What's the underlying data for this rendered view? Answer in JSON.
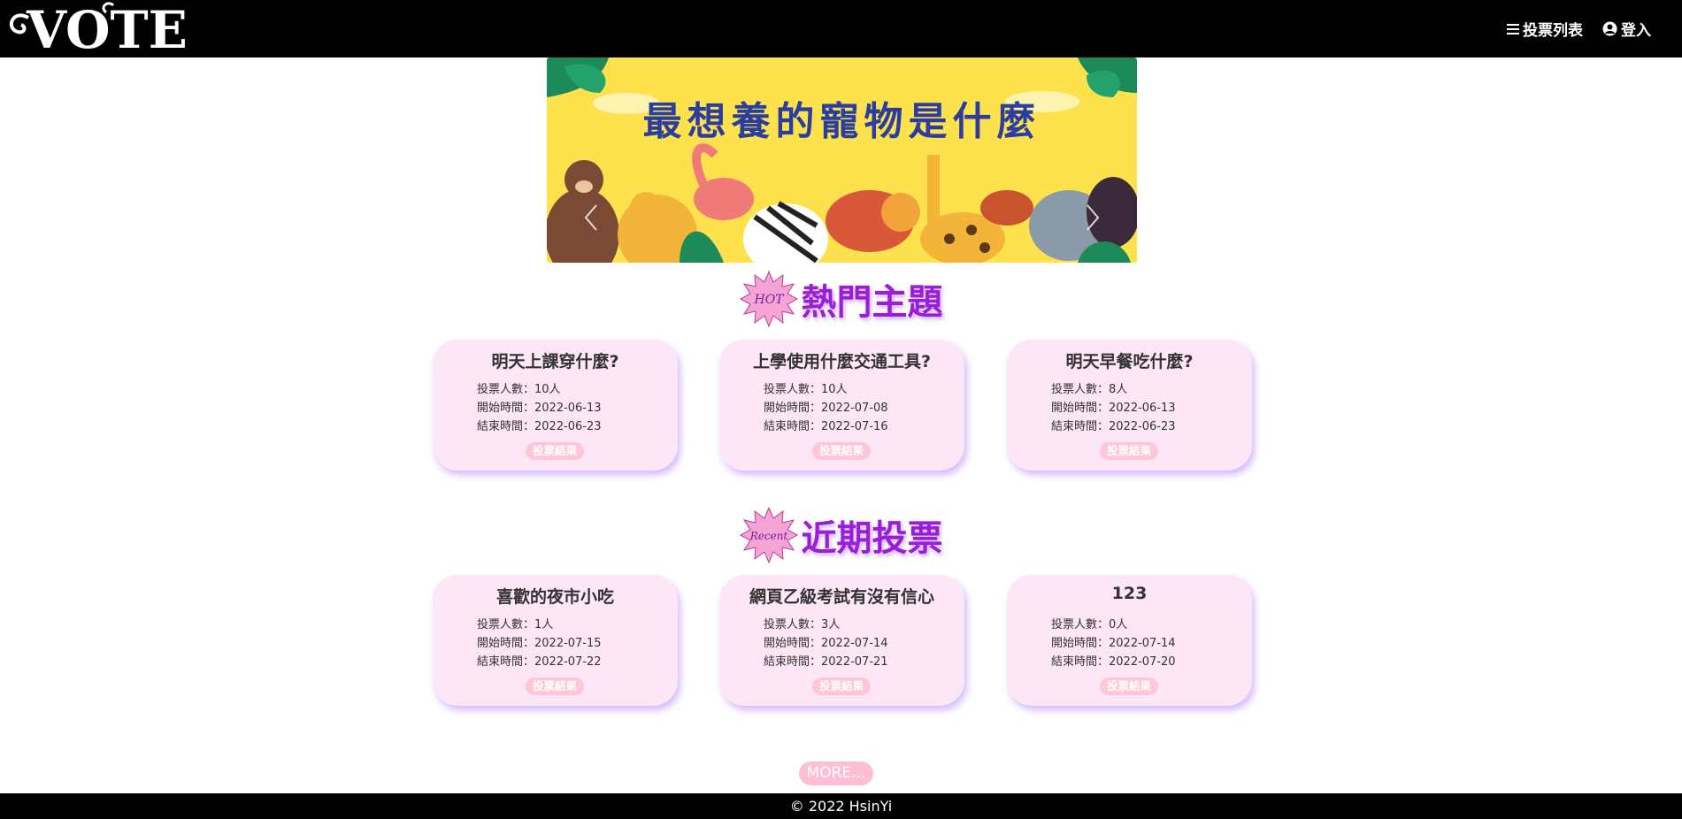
{
  "header": {
    "logo_text": "VOTE",
    "nav": [
      {
        "label": "投票列表",
        "icon": "menu-icon"
      },
      {
        "label": "登入",
        "icon": "user-circle-icon"
      }
    ]
  },
  "banner": {
    "title": "最想養的寵物是什麼",
    "background_color": "#fde24d"
  },
  "sections": {
    "hot": {
      "badge": "HOT",
      "title": "熱門主題",
      "cards": [
        {
          "title": "明天上課穿什麼?",
          "votes_label": "投票人數：10人",
          "start_label": "開始時間：2022-06-13",
          "end_label": "結束時間：2022-06-23",
          "button": "投票結果"
        },
        {
          "title": "上學使用什麼交通工具?",
          "votes_label": "投票人數：10人",
          "start_label": "開始時間：2022-07-08",
          "end_label": "結束時間：2022-07-16",
          "button": "投票結果"
        },
        {
          "title": "明天早餐吃什麼?",
          "votes_label": "投票人數：8人",
          "start_label": "開始時間：2022-06-13",
          "end_label": "結束時間：2022-06-23",
          "button": "投票結果"
        }
      ]
    },
    "recent": {
      "badge": "Recent",
      "title": "近期投票",
      "cards": [
        {
          "title": "喜歡的夜市小吃",
          "votes_label": "投票人數：1人",
          "start_label": "開始時間：2022-07-15",
          "end_label": "結束時間：2022-07-22",
          "button": "投票結果"
        },
        {
          "title": "網頁乙級考試有沒有信心",
          "votes_label": "投票人數：3人",
          "start_label": "開始時間：2022-07-14",
          "end_label": "結束時間：2022-07-21",
          "button": "投票結果"
        },
        {
          "title": "123",
          "votes_label": "投票人數：0人",
          "start_label": "開始時間：2022-07-14",
          "end_label": "結束時間：2022-07-20",
          "button": "投票結果"
        }
      ]
    }
  },
  "more_button": "MORE...",
  "footer": {
    "text": "© 2022 HsinYi"
  },
  "colors": {
    "accent_purple": "#9b1ddc",
    "card_bg": "#fde6f6",
    "button_pink": "#ffc6d8",
    "header_bg": "#000000"
  }
}
